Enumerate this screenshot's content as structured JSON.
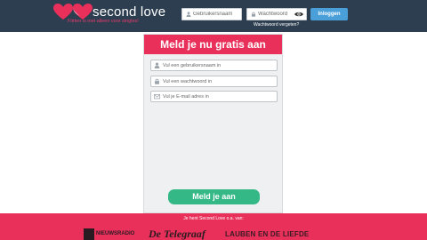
{
  "header": {
    "logo_text": "second love",
    "tagline": "Flirten is niet alleen voor singles!",
    "username_placeholder": "Gebruikersnaam",
    "password_placeholder": "Wachtwoord",
    "login_label": "Inloggen",
    "forgot_label": "Wachtwoord vergeten?",
    "colors": {
      "bar": "#2c3e50",
      "accent": "#e83a6a",
      "button": "#4a9fd9"
    }
  },
  "register": {
    "title": "Meld je nu gratis aan",
    "username_placeholder": "Vul een gebruikersnaam in",
    "password_placeholder": "Vul een wachtwoord in",
    "email_placeholder": "Vul je E-mail adres in",
    "submit_label": "Meld je aan",
    "colors": {
      "header": "#e8305a",
      "submit": "#33b886"
    }
  },
  "footer": {
    "text": "Je hent Second Love o.a. van:",
    "press": [
      "NIEUWSRADIO",
      "De Telegraaf",
      "LAUBEN EN DE LIEFDE"
    ],
    "icons": {
      "user": "user-icon",
      "lock": "lock-icon",
      "email": "envelope-icon",
      "eye": "eye-icon"
    }
  }
}
